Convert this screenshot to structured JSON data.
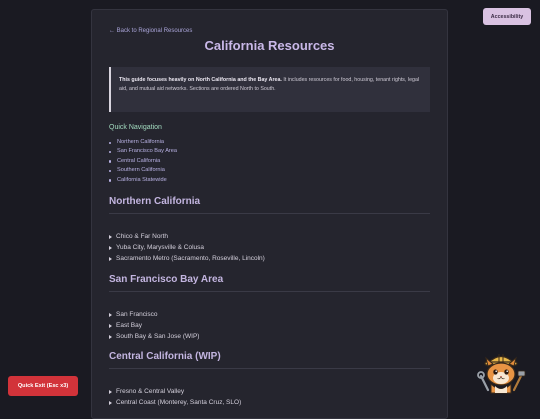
{
  "header": {
    "back_link": "← Back to Regional Resources",
    "title": "California Resources"
  },
  "notice": {
    "bold_text": "This guide focuses heavily on North California and the Bay Area.",
    "text": " It includes resources for food, housing, tenant rights, legal aid, and mutual aid networks. Sections are ordered North to South."
  },
  "quick_nav": {
    "heading": "Quick Navigation",
    "items": [
      "Northern California",
      "San Francisco Bay Area",
      "Central California",
      "Southern California",
      "California Statewide"
    ]
  },
  "sections": [
    {
      "heading": "Northern California",
      "items": [
        "Chico & Far North",
        "Yuba City, Marysville & Colusa",
        "Sacramento Metro (Sacramento, Roseville, Lincoln)"
      ]
    },
    {
      "heading": "San Francisco Bay Area",
      "items": [
        "San Francisco",
        "East Bay",
        "South Bay & San Jose (WIP)"
      ]
    },
    {
      "heading": "Central California (WIP)",
      "items": [
        "Fresno & Central Valley",
        "Central Coast (Monterey, Santa Cruz, SLO)"
      ]
    }
  ],
  "buttons": {
    "accessibility": "Accessibility",
    "quick_exit": "Quick Exit (Esc x3)"
  },
  "icons": {
    "mascot": "cat-mascot-icon"
  },
  "colors": {
    "background": "#1a1a22",
    "panel": "#25252e",
    "title": "#c9b8e8",
    "nav_heading": "#a3dcc0",
    "link": "#b9b2e4",
    "quick_exit": "#d2333a",
    "accessibility": "#d9c2e2"
  }
}
